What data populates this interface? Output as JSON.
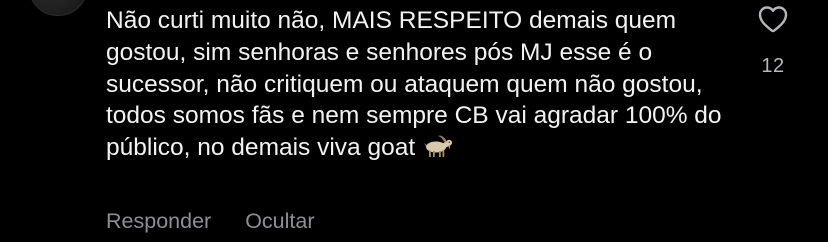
{
  "comment": {
    "text": "Não curti muito não, MAIS RESPEITO demais quem gostou, sim senhoras e senhores pós MJ esse é o sucessor, não critiquem ou ataquem quem não gostou, todos somos fãs e nem sempre CB vai agradar 100% do público, no demais viva goat",
    "emoji": "goat-icon"
  },
  "actions": {
    "reply_label": "Responder",
    "hide_label": "Ocultar"
  },
  "like": {
    "icon": "heart-outline-icon",
    "count": "12"
  },
  "colors": {
    "background": "#000000",
    "text": "#f2f2f2",
    "secondary": "#8e8e93"
  }
}
